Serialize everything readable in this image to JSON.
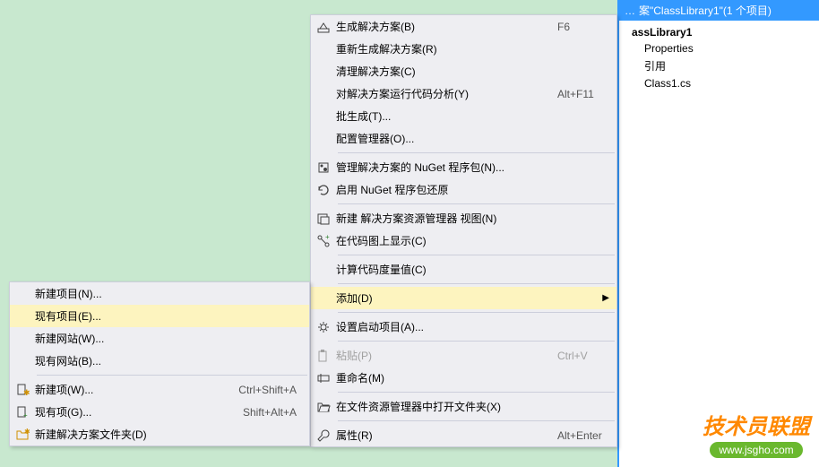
{
  "solution": {
    "header_prefix": "…",
    "header": "案\"ClassLibrary1\"(1 个项目)",
    "project": "assLibrary1",
    "properties": "Properties",
    "references": "引用",
    "file": "Class1.cs"
  },
  "main_menu": [
    {
      "icon": "build",
      "label": "生成解决方案(B)",
      "shortcut": "F6"
    },
    {
      "icon": "",
      "label": "重新生成解决方案(R)",
      "shortcut": ""
    },
    {
      "icon": "",
      "label": "清理解决方案(C)",
      "shortcut": ""
    },
    {
      "icon": "",
      "label": "对解决方案运行代码分析(Y)",
      "shortcut": "Alt+F11"
    },
    {
      "icon": "",
      "label": "批生成(T)...",
      "shortcut": ""
    },
    {
      "icon": "",
      "label": "配置管理器(O)...",
      "shortcut": ""
    },
    {
      "sep": true
    },
    {
      "icon": "nuget",
      "label": "管理解决方案的 NuGet 程序包(N)...",
      "shortcut": ""
    },
    {
      "icon": "restore",
      "label": "启用 NuGet 程序包还原",
      "shortcut": ""
    },
    {
      "sep": true
    },
    {
      "icon": "newview",
      "label": "新建 解决方案资源管理器 视图(N)",
      "shortcut": ""
    },
    {
      "icon": "codemap",
      "label": "在代码图上显示(C)",
      "shortcut": ""
    },
    {
      "sep": true
    },
    {
      "icon": "",
      "label": "计算代码度量值(C)",
      "shortcut": ""
    },
    {
      "sep": true
    },
    {
      "icon": "",
      "label": "添加(D)",
      "shortcut": "",
      "submenu": true,
      "highlighted": true
    },
    {
      "sep": true
    },
    {
      "icon": "gear",
      "label": "设置启动项目(A)...",
      "shortcut": ""
    },
    {
      "sep": true
    },
    {
      "icon": "paste",
      "label": "粘贴(P)",
      "shortcut": "Ctrl+V",
      "disabled": true
    },
    {
      "icon": "rename",
      "label": "重命名(M)",
      "shortcut": ""
    },
    {
      "sep": true
    },
    {
      "icon": "folder-open",
      "label": "在文件资源管理器中打开文件夹(X)",
      "shortcut": ""
    },
    {
      "sep": true
    },
    {
      "icon": "wrench",
      "label": "属性(R)",
      "shortcut": "Alt+Enter"
    }
  ],
  "sub_menu": [
    {
      "icon": "",
      "label": "新建项目(N)...",
      "shortcut": ""
    },
    {
      "icon": "",
      "label": "现有项目(E)...",
      "shortcut": "",
      "highlighted": true
    },
    {
      "icon": "",
      "label": "新建网站(W)...",
      "shortcut": ""
    },
    {
      "icon": "",
      "label": "现有网站(B)...",
      "shortcut": ""
    },
    {
      "sep": true
    },
    {
      "icon": "newitem",
      "label": "新建项(W)...",
      "shortcut": "Ctrl+Shift+A"
    },
    {
      "icon": "existitem",
      "label": "现有项(G)...",
      "shortcut": "Shift+Alt+A"
    },
    {
      "icon": "newfolder",
      "label": "新建解决方案文件夹(D)",
      "shortcut": ""
    }
  ],
  "watermark": {
    "line1": "技术员联盟",
    "line2": "www.jsgho.com"
  }
}
